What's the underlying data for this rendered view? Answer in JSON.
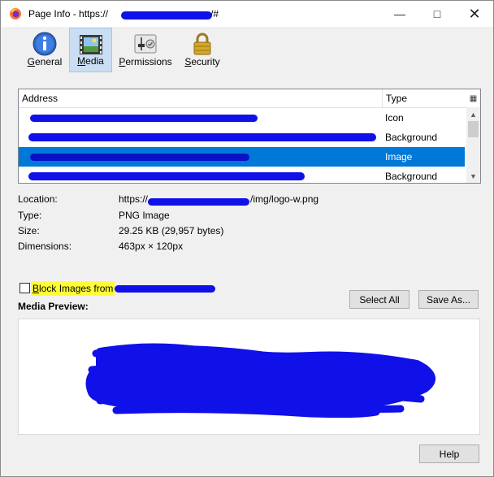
{
  "window": {
    "title": "Page Info - https://",
    "title_suffix": "/#"
  },
  "tabs": [
    {
      "label": "General",
      "accel": "G",
      "rest": "eneral",
      "selected": false
    },
    {
      "label": "Media",
      "accel": "M",
      "rest": "edia",
      "selected": true
    },
    {
      "label": "Permissions",
      "accel": "P",
      "rest": "ermissions",
      "selected": false
    },
    {
      "label": "Security",
      "accel": "S",
      "rest": "ecurity",
      "selected": false
    }
  ],
  "table": {
    "columns": [
      "Address",
      "Type"
    ],
    "rows": [
      {
        "address": "",
        "type": "Icon",
        "selected": false
      },
      {
        "address": "",
        "type": "Background",
        "selected": false
      },
      {
        "address": "",
        "type": "Image",
        "selected": true
      },
      {
        "address": "",
        "type": "Background",
        "selected": false
      }
    ]
  },
  "details": {
    "location_label": "Location:",
    "location_value_prefix": "https://",
    "location_value_suffix": "/img/logo-w.png",
    "type_label": "Type:",
    "type_value": "PNG Image",
    "size_label": "Size:",
    "size_value": "29.25 KB (29,957 bytes)",
    "dimensions_label": "Dimensions:",
    "dimensions_value": "463px × 120px"
  },
  "block": {
    "label": "Block Images from",
    "accel": "B",
    "rest": "lock Images from",
    "checked": false
  },
  "buttons": {
    "select_all": "Select All",
    "save_as": "Save As...",
    "help": "Help"
  },
  "preview_label": "Media Preview:",
  "colors": {
    "selection": "#0078d7",
    "tab_selected": "#c9ddf3",
    "highlight": "#ffff33",
    "redaction": "#1010e8"
  }
}
